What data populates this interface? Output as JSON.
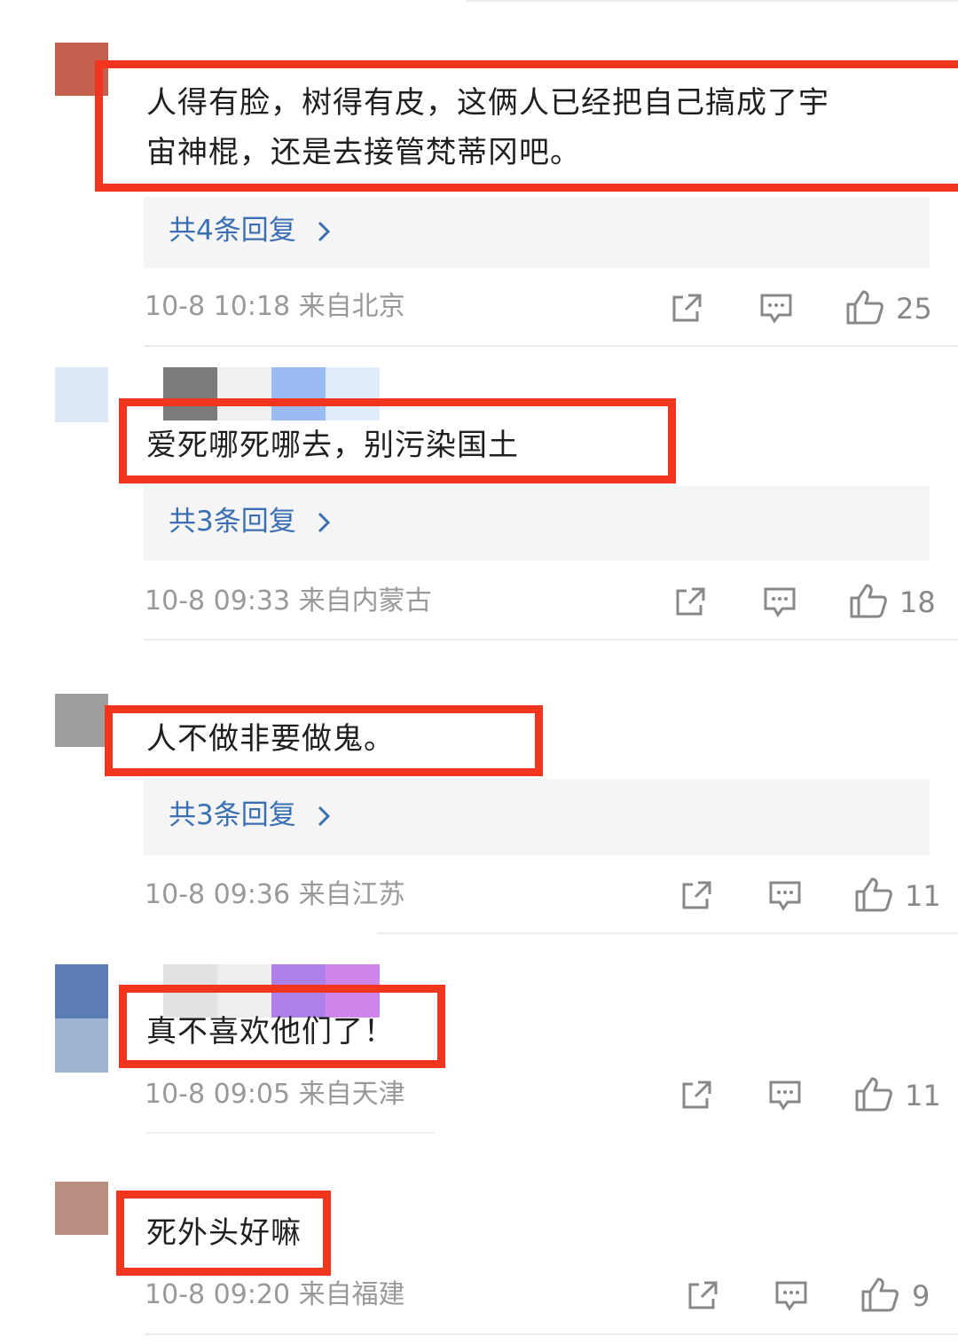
{
  "comments": [
    {
      "text_lines": [
        "人得有脸，树得有皮，这俩人已经把自己搞成了宇",
        "宙神棍，还是去接管梵蒂冈吧。"
      ],
      "replies_label": "共4条回复",
      "time": "10-8 10:18",
      "location": "来自北京",
      "likes": "25",
      "avatar_color": "#c4604f"
    },
    {
      "text_lines": [
        "爱死哪死哪去，别污染国土"
      ],
      "replies_label": "共3条回复",
      "time": "10-8 09:33",
      "location": "来自内蒙古",
      "likes": "18",
      "avatar_color": "#dde9f4"
    },
    {
      "text_lines": [
        "人不做非要做鬼。"
      ],
      "replies_label": "共3条回复",
      "time": "10-8 09:36",
      "location": "来自江苏",
      "likes": "11",
      "avatar_color": "#9e9e9e"
    },
    {
      "text_lines": [
        "真不喜欢他们了！"
      ],
      "time": "10-8 09:05",
      "location": "来自天津",
      "likes": "11",
      "avatar_color": "#5b7db3"
    },
    {
      "text_lines": [
        "死外头好嘛"
      ],
      "time": "10-8 09:20",
      "location": "来自福建",
      "likes": "9",
      "avatar_color": "#b88e80"
    }
  ],
  "colors": {
    "highlight_box": "#f2351f",
    "reply_link": "#3a6fb3",
    "meta_text": "#999999"
  }
}
